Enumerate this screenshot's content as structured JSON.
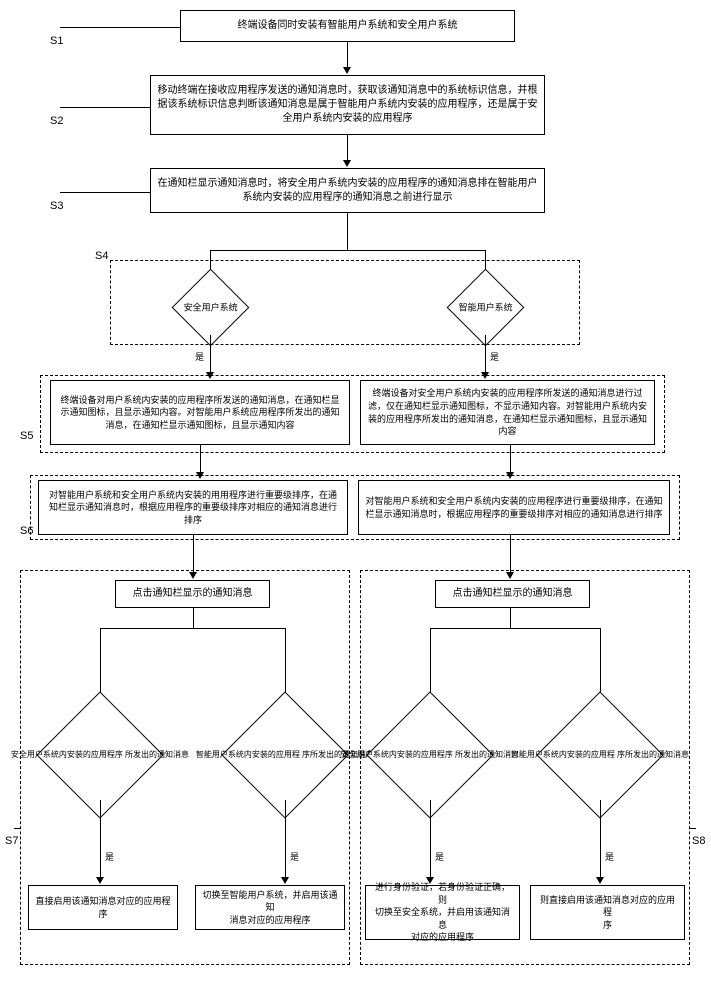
{
  "labels": {
    "s1": "S1",
    "s2": "S2",
    "s3": "S3",
    "s4": "S4",
    "s5": "S5",
    "s6": "S6",
    "s7": "S7",
    "s8": "S8"
  },
  "boxes": {
    "b1": "终端设备同时安装有智能用户系统和安全用户系统",
    "b2": "移动终端在接收应用程序发送的通知消息时，获取该通知消息中的系统标识信息，并根据该系统标识信息判断该通知消息是属于智能用户系统内安装的应用程序，还是属于安全用户系统内安装的应用程序",
    "b3": "在通知栏显示通知消息时，将安全用户系统内安装的应用程序的通知消息排在智能用户系统内安装的应用程序的通知消息之前进行显示",
    "d_safe": "安全用户系统",
    "d_smart": "智能用户系统",
    "b5_left": "终端设备对用户系统内安装的应用程序所发送的通知消息，在通知栏显示通知图标，且显示通知内容。对智能用户系统应用程序所发出的通知消息，在通知栏显示通知图标，且显示通知内容",
    "b5_right": "终端设备对安全用户系统内安装的应用程序所发送的通知消息进行过滤，仅在通知栏显示通知图标，不显示通知内容。对智能用户系统内安装的应用程序所发出的通知消息，在通知栏显示通知图标，且显示通知内容",
    "b6_left": "对智能用户系统和安全用户系统内安装的用用程序进行重要级排序，在通知栏显示通知消息时，根据应用程序的重要级排序对相应的通知消息进行排序",
    "b6_right": "对智能用户系统和安全用户系统内安装的应用程序进行重要级排序，在通知栏显示通知消息时，根据应用程序的重要级排序对相应的通知消息进行排序",
    "b7_click": "点击通知栏显示的通知消息",
    "b8_click": "点击通知栏显示的通知消息",
    "d7_left": "安全用户系统内安装的应用程序\n所发出的通知消息",
    "d7_right": "智能用户系统内安装的应用程\n序所发出的通知消息",
    "d8_left": "安全用户系统内安装的应用程序\n所发出的通知消息",
    "d8_right": "智能用户系统内安装的应用程\n序所发出的通知消息",
    "b7_result_left": "直接启用该通知消息对应的应用程序",
    "b7_result_right": "切换至智能用户系统，并启用该通知\n消息对应的应用程序",
    "b8_result_left": "进行身份验证，若身份验证正确，则\n切换至安全系统，并启用该通知消息\n对应的应用程序",
    "b8_result_right": "则直接启用该通知消息对应的应用程\n序"
  },
  "yes": "是"
}
